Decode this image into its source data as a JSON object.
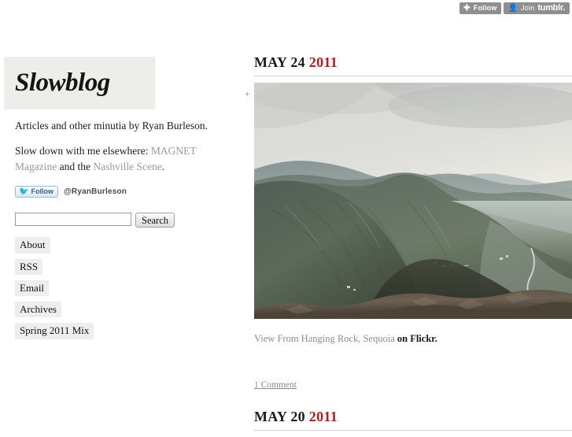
{
  "tumblr_bar": {
    "follow_button": {
      "icon": "plus-icon",
      "label": "Follow"
    },
    "join_button": {
      "icon": "person-icon",
      "label": "Join",
      "brand": "tumblr."
    }
  },
  "sidebar": {
    "logo": "Slowblog",
    "tagline": "Articles and other minutia by Ryan Burleson.",
    "elsewhere": {
      "prefix": "Slow down with me elsewhere: ",
      "link1": "MAGNET Magazine",
      "middle": " and the ",
      "link2": "Nashville Scene",
      "suffix": "."
    },
    "twitter": {
      "follow_label": "Follow",
      "bird_icon": "twitter-bird-icon",
      "handle": "@RyanBurleson"
    },
    "search": {
      "value": "",
      "placeholder": "",
      "button_label": "Search"
    },
    "nav_items": [
      {
        "label": "About"
      },
      {
        "label": "RSS"
      },
      {
        "label": "Email"
      },
      {
        "label": "Archives"
      },
      {
        "label": "Spring 2011 Mix"
      }
    ]
  },
  "main": {
    "posts": [
      {
        "date_month_day": "MAY 24",
        "date_year": "2011",
        "plus_marker": "+",
        "photo_alt": "Hazy view of forested mountain ridges from Hanging Rock, Sequoia",
        "caption_text": "View From Hanging Rock, Sequoia",
        "caption_link": "on Flickr.",
        "comments_label": "1 Comment"
      },
      {
        "date_month_day": "MAY 20",
        "date_year": "2011"
      }
    ]
  },
  "colors": {
    "accent_red": "#b01b1b",
    "link_gray": "#9a9a9a",
    "logo_bg": "#ededeb",
    "nav_bg": "#eeeeee",
    "tumblr_btn_bg": "#8f8f8f",
    "twitter_blue": "#45a3e0"
  }
}
